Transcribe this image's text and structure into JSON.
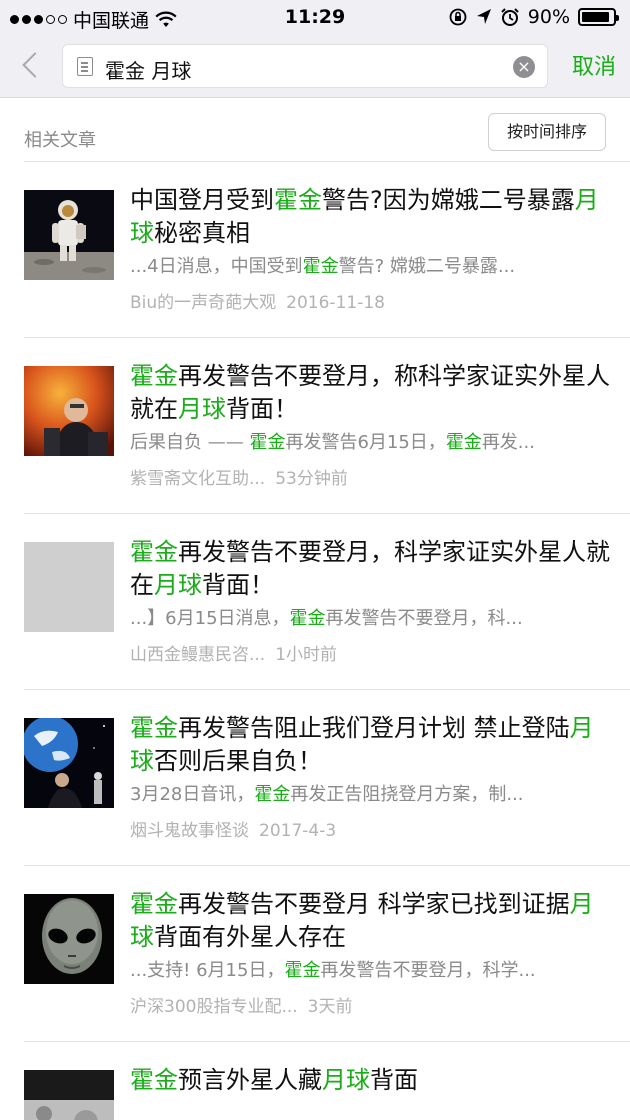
{
  "status_bar": {
    "carrier": "中国联通",
    "time": "11:29",
    "battery": "90%",
    "battery_level": 0.9,
    "icons": [
      "signal-dots-icon",
      "wifi-icon",
      "orientation-lock-icon",
      "location-icon",
      "alarm-icon",
      "battery-icon"
    ]
  },
  "search": {
    "query": "霍金 月球",
    "cancel_label": "取消"
  },
  "section": {
    "title": "相关文章",
    "sort_label": "按时间排序"
  },
  "results": [
    {
      "title": [
        "中国登月受到",
        {
          "hl": "霍金"
        },
        "警告?因为嫦娥二号暴露",
        {
          "hl": "月球"
        },
        "秘密真相"
      ],
      "snippet": [
        "...4日消息，中国受到",
        {
          "hl": "霍金"
        },
        "警告? 嫦娥二号暴露..."
      ],
      "source": "Biu的一声奇葩大观",
      "time": "2016-11-18",
      "thumb": "astronaut"
    },
    {
      "title": [
        {
          "hl": "霍金"
        },
        "再发警告不要登月，称科学家证实外星人就在",
        {
          "hl": "月球"
        },
        "背面！"
      ],
      "snippet": [
        "后果自负 —— ",
        {
          "hl": "霍金"
        },
        "再发警告6月15日，",
        {
          "hl": "霍金"
        },
        "再发..."
      ],
      "source": "紫雪斋文化互助...",
      "time": "53分钟前",
      "thumb": "hawking-fire"
    },
    {
      "title": [
        {
          "hl": "霍金"
        },
        "再发警告不要登月，科学家证实外星人就在",
        {
          "hl": "月球"
        },
        "背面！"
      ],
      "snippet": [
        "...】6月15日消息，",
        {
          "hl": "霍金"
        },
        "再发警告不要登月，科..."
      ],
      "source": "山西金鳗惠民咨...",
      "time": "1小时前",
      "thumb": "placeholder"
    },
    {
      "title": [
        {
          "hl": "霍金"
        },
        "再发警告阻止我们登月计划 禁止登陆",
        {
          "hl": "月球"
        },
        "否则后果自负！"
      ],
      "snippet": [
        "3月28日音讯，",
        {
          "hl": "霍金"
        },
        "再发正告阻挠登月方案，制..."
      ],
      "source": "烟斗鬼故事怪谈",
      "time": "2017-4-3",
      "thumb": "hawking-space"
    },
    {
      "title": [
        {
          "hl": "霍金"
        },
        "再发警告不要登月 科学家已找到证据",
        {
          "hl": "月球"
        },
        "背面有外星人存在"
      ],
      "snippet": [
        "...支持! 6月15日，",
        {
          "hl": "霍金"
        },
        "再发警告不要登月，科学..."
      ],
      "source": "沪深300股指专业配...",
      "time": "3天前",
      "thumb": "alien"
    },
    {
      "title": [
        {
          "hl": "霍金"
        },
        "预言外星人藏",
        {
          "hl": "月球"
        },
        "背面"
      ],
      "snippet": [],
      "source": "",
      "time": "",
      "thumb": "moon-surface"
    }
  ]
}
